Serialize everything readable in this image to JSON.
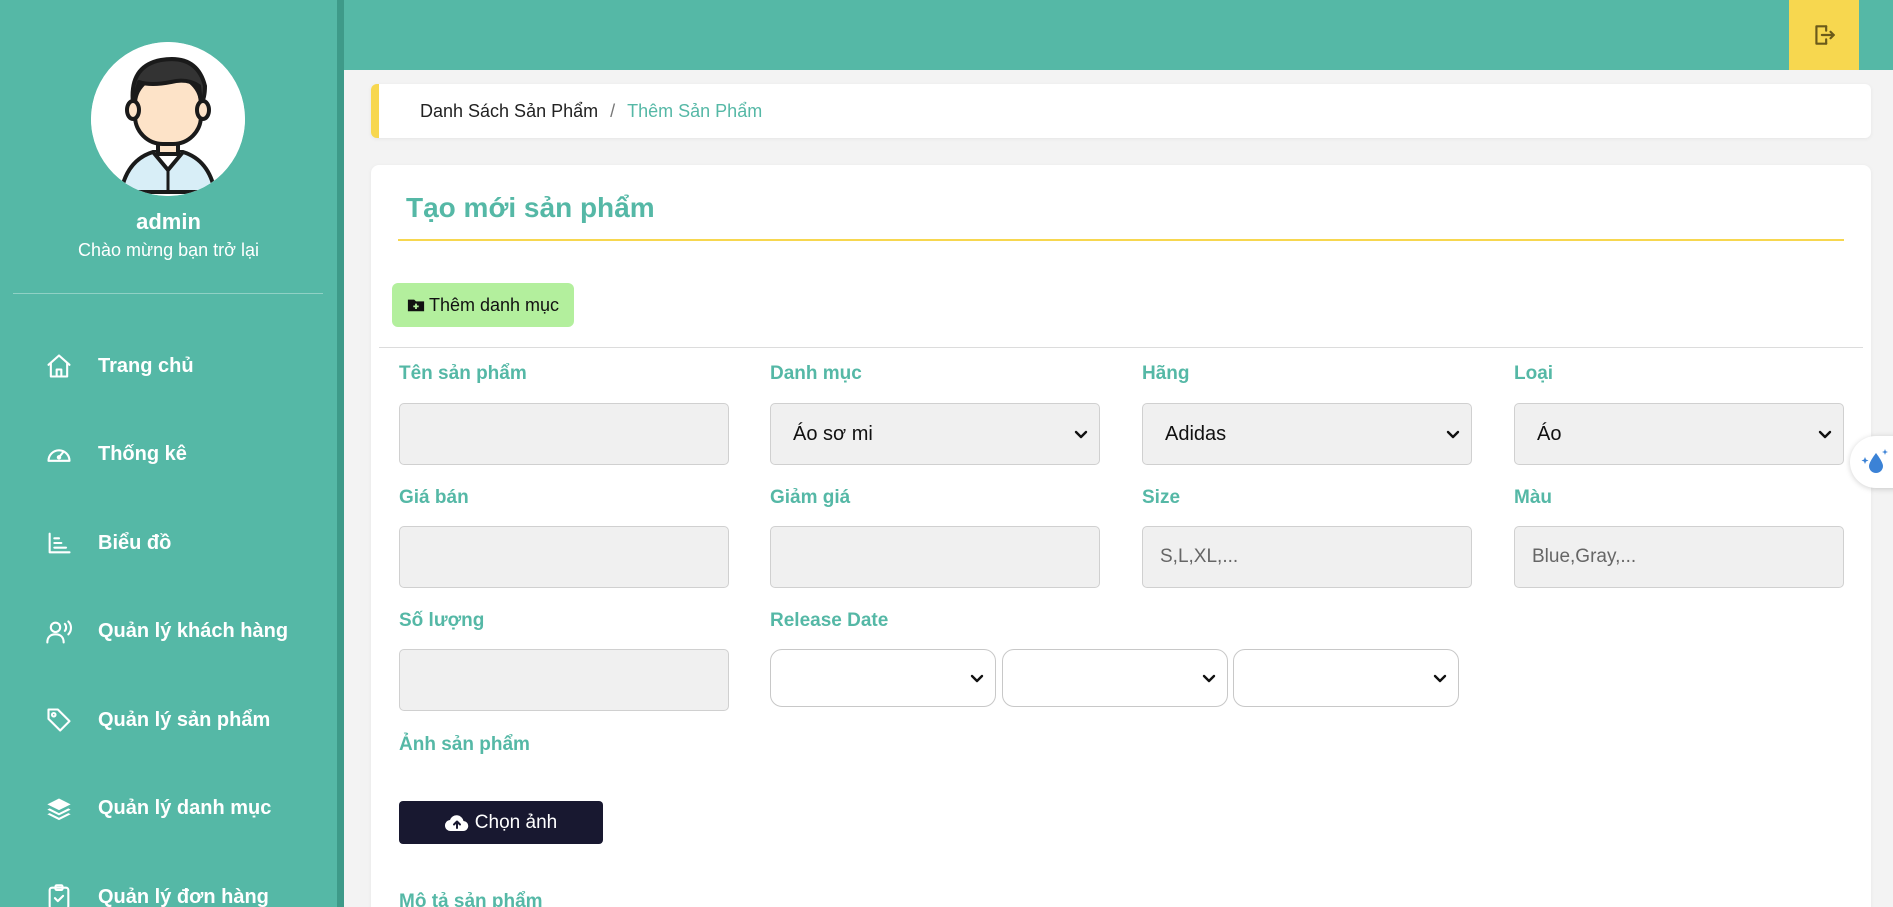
{
  "user": {
    "name": "admin",
    "greeting": "Chào mừng bạn trở lại"
  },
  "sidebar": {
    "items": [
      {
        "label": "Trang chủ",
        "icon": "home-icon"
      },
      {
        "label": "Thống kê",
        "icon": "gauge-icon"
      },
      {
        "label": "Biểu đồ",
        "icon": "bar-chart-icon"
      },
      {
        "label": "Quản lý khách hàng",
        "icon": "user-voice-icon"
      },
      {
        "label": "Quản lý sản phẩm",
        "icon": "tag-icon"
      },
      {
        "label": "Quản lý danh mục",
        "icon": "layers-icon"
      },
      {
        "label": "Quản lý đơn hàng",
        "icon": "clipboard-check-icon"
      }
    ]
  },
  "topbar": {
    "logout_icon": "logout-icon"
  },
  "breadcrumb": {
    "parent": "Danh Sách Sản Phẩm",
    "separator": "/",
    "current": "Thêm Sản Phẩm"
  },
  "form": {
    "title": "Tạo mới sản phẩm",
    "add_category_label": "Thêm danh mục",
    "fields": {
      "name": {
        "label": "Tên sản phẩm",
        "value": "",
        "placeholder": ""
      },
      "category": {
        "label": "Danh mục",
        "selected": "Áo sơ mi"
      },
      "brand": {
        "label": "Hãng",
        "selected": "Adidas"
      },
      "type": {
        "label": "Loại",
        "selected": "Áo"
      },
      "price": {
        "label": "Giá bán",
        "value": "",
        "placeholder": ""
      },
      "discount": {
        "label": "Giảm giá",
        "value": "",
        "placeholder": ""
      },
      "size": {
        "label": "Size",
        "value": "",
        "placeholder": "S,L,XL,..."
      },
      "color": {
        "label": "Màu",
        "value": "",
        "placeholder": "Blue,Gray,..."
      },
      "quantity": {
        "label": "Số lượng",
        "value": "",
        "placeholder": ""
      },
      "release_date": {
        "label": "Release Date",
        "day": "",
        "month": "",
        "year": ""
      },
      "image": {
        "label": "Ảnh sản phẩm",
        "button_label": "Chọn ảnh"
      },
      "description": {
        "label": "Mô tả sản phẩm"
      }
    }
  },
  "colors": {
    "primary": "#55b8a6",
    "accent": "#f7d74f",
    "add_button": "#b3ef9d",
    "dark_button": "#181830"
  }
}
